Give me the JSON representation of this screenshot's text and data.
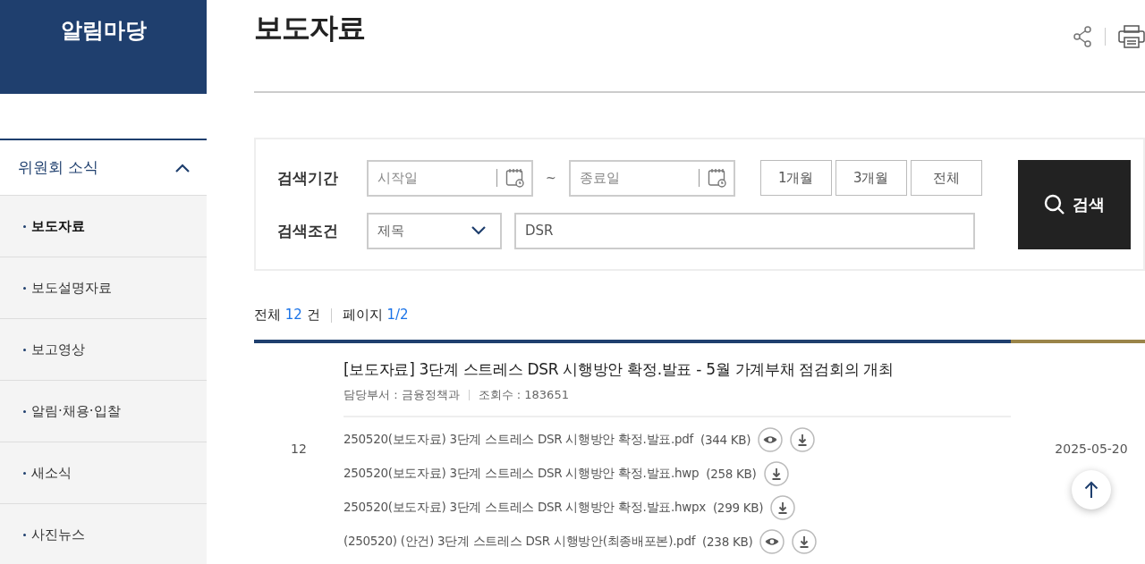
{
  "sidebar": {
    "header": "알림마당",
    "section": {
      "title": "위원회 소식",
      "expanded": true
    },
    "items": [
      {
        "label": "보도자료",
        "selected": true
      },
      {
        "label": "보도설명자료",
        "selected": false
      },
      {
        "label": "보고영상",
        "selected": false
      },
      {
        "label": "알림·채용·입찰",
        "selected": false
      },
      {
        "label": "새소식",
        "selected": false
      },
      {
        "label": "사진뉴스",
        "selected": false
      }
    ]
  },
  "page": {
    "title": "보도자료"
  },
  "search": {
    "period_label": "검색기간",
    "start_placeholder": "시작일",
    "separator": "~",
    "end_placeholder": "종료일",
    "range_buttons": [
      "1개월",
      "3개월",
      "전체"
    ],
    "condition_label": "검색조건",
    "condition_select": "제목",
    "keyword": "DSR",
    "search_button": "검색"
  },
  "summary": {
    "total_label": "전체",
    "total_count": "12",
    "total_unit": "건",
    "page_label": "페이지",
    "page_value": "1/2"
  },
  "rows": [
    {
      "number": "12",
      "title": "[보도자료] 3단계 스트레스 DSR 시행방안 확정.발표 - 5월 가계부채 점검회의 개최",
      "department": "담당부서 : 금융정책과",
      "views": "조회수 : 183651",
      "date": "2025-05-20",
      "files": [
        {
          "name": "250520(보도자료) 3단계 스트레스 DSR 시행방안 확정.발표.pdf",
          "size": "(344 KB)",
          "preview": true
        },
        {
          "name": "250520(보도자료) 3단계 스트레스 DSR 시행방안 확정.발표.hwp",
          "size": "(258 KB)",
          "preview": false
        },
        {
          "name": "250520(보도자료) 3단계 스트레스 DSR 시행방안 확정.발표.hwpx",
          "size": "(299 KB)",
          "preview": false
        },
        {
          "name": "(250520) (안건) 3단계 스트레스 DSR 시행방안(최종배포본).pdf",
          "size": "(238 KB)",
          "preview": true
        }
      ]
    }
  ]
}
